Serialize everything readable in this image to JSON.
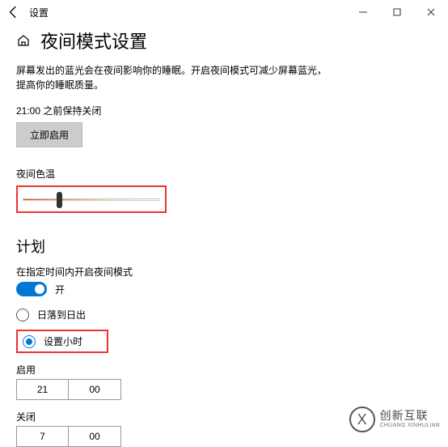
{
  "titlebar": {
    "title": "设置"
  },
  "page": {
    "title": "夜间模式设置",
    "desc_line1": "屏幕发出的蓝光会在夜间影响你的睡眠。开启夜间模式可减少屏幕蓝光，",
    "desc_line2": "提高你的睡眠质量。",
    "status": "21:00 之前保持关闭",
    "enable_now": "立即启用"
  },
  "color_temp": {
    "label": "夜间色温"
  },
  "schedule": {
    "title": "计划",
    "toggle_label": "在指定时间内开启夜间模式",
    "toggle_state": "开",
    "option_sunset": "日落到日出",
    "option_hours": "设置小时",
    "on_label": "启用",
    "on_hour": "21",
    "on_min": "00",
    "off_label": "关闭",
    "off_hour": "7",
    "off_min": "00"
  },
  "watermark": {
    "zh": "创新互联",
    "en": "CHUANG XINHULIAN"
  }
}
